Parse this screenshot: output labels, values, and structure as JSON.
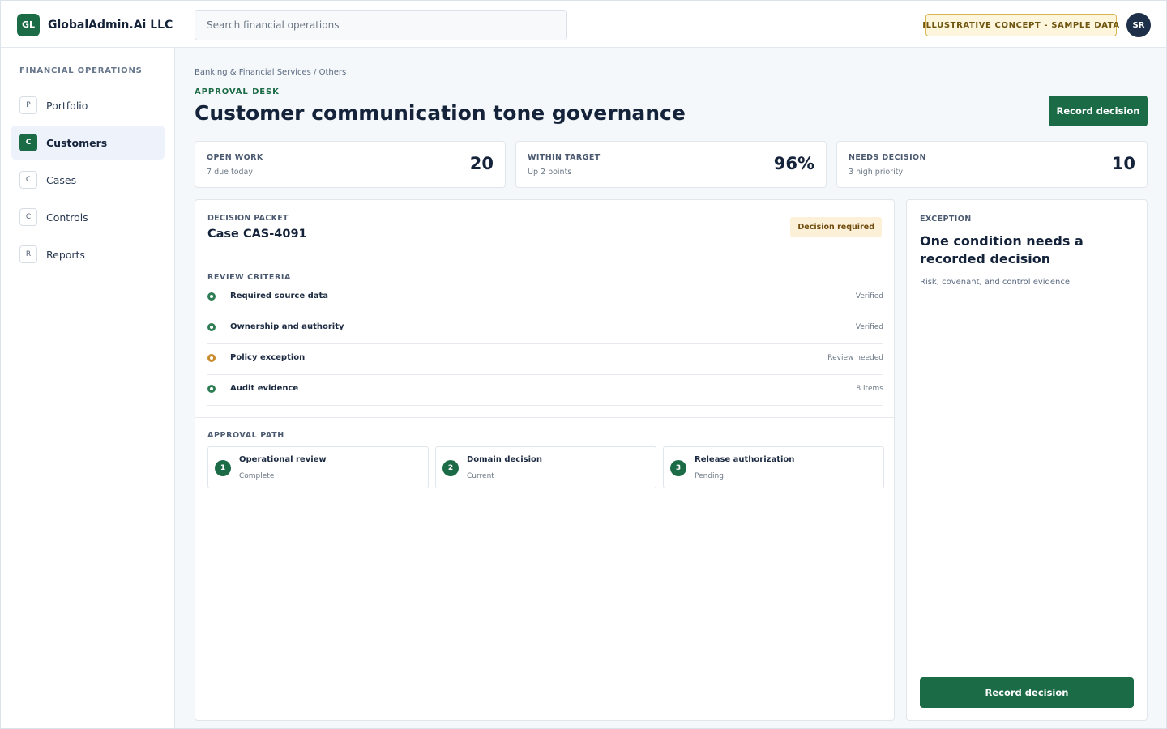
{
  "brand": {
    "logo": "GL",
    "name": "GlobalAdmin.Ai LLC"
  },
  "search": {
    "placeholder": "Search financial operations"
  },
  "header": {
    "badge": "ILLUSTRATIVE CONCEPT - SAMPLE DATA",
    "avatar": "SR"
  },
  "sidebar": {
    "title": "FINANCIAL OPERATIONS",
    "items": [
      {
        "chip": "P",
        "label": "Portfolio"
      },
      {
        "chip": "C",
        "label": "Customers",
        "active": true
      },
      {
        "chip": "C",
        "label": "Cases"
      },
      {
        "chip": "C",
        "label": "Controls"
      },
      {
        "chip": "R",
        "label": "Reports"
      }
    ]
  },
  "page": {
    "breadcrumb": "Banking & Financial Services / Others",
    "eyebrow": "APPROVAL DESK",
    "title": "Customer communication tone governance",
    "primary_action": "Record decision"
  },
  "kpis": [
    {
      "label": "OPEN WORK",
      "sub": "7 due today",
      "value": "20"
    },
    {
      "label": "WITHIN TARGET",
      "sub": "Up 2 points",
      "value": "96%"
    },
    {
      "label": "NEEDS DECISION",
      "sub": "3 high priority",
      "value": "10"
    }
  ],
  "packet": {
    "label": "DECISION PACKET",
    "case": "Case CAS-4091",
    "status": "Decision required",
    "criteria_title": "REVIEW CRITERIA",
    "criteria": [
      {
        "label": "Required source data",
        "status": "Verified"
      },
      {
        "label": "Ownership and authority",
        "status": "Verified"
      },
      {
        "label": "Policy exception",
        "status": "Review needed"
      },
      {
        "label": "Audit evidence",
        "status": "8 items"
      }
    ],
    "path_title": "APPROVAL PATH",
    "steps": [
      {
        "num": "1",
        "name": "Operational review",
        "state": "Complete"
      },
      {
        "num": "2",
        "name": "Domain decision",
        "state": "Current"
      },
      {
        "num": "3",
        "name": "Release authorization",
        "state": "Pending"
      }
    ]
  },
  "exception": {
    "label": "EXCEPTION",
    "title": "One condition needs a recorded decision",
    "sub": "Risk, covenant, and control evidence",
    "action": "Record decision"
  },
  "colors": {
    "accent": "#1c6b47",
    "warning": "#c88a2a",
    "navy": "#1e2f4a"
  }
}
